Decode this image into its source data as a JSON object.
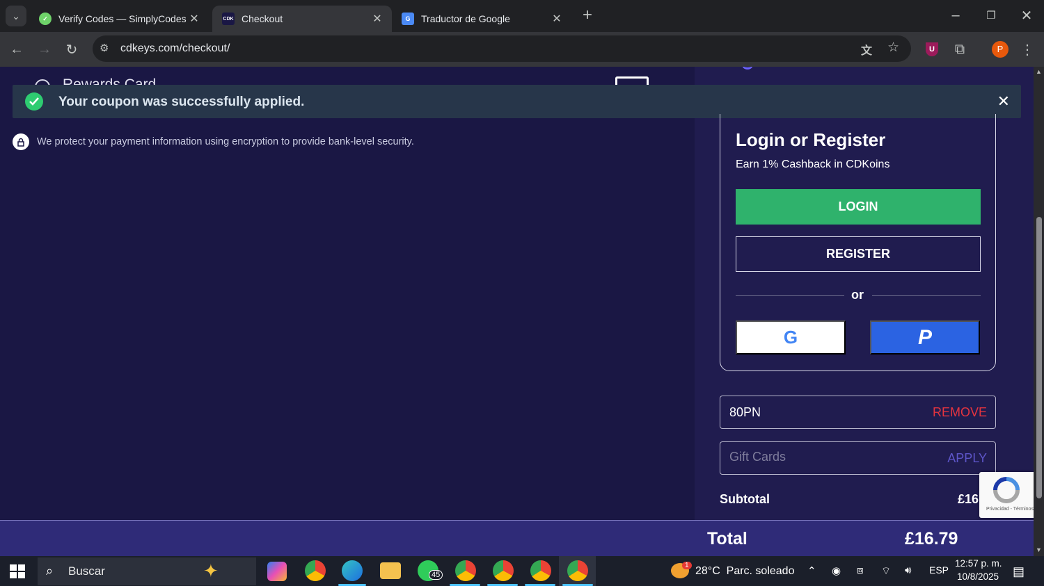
{
  "browser": {
    "tabs": [
      {
        "title": "Verify Codes — SimplyCodes",
        "favicon": "simplycodes-icon"
      },
      {
        "title": "Checkout",
        "favicon": "cdkeys-icon",
        "favicon_text": "CDK"
      },
      {
        "title": "Traductor de Google",
        "favicon": "google-translate-icon"
      }
    ],
    "url": "cdkeys.com/checkout/",
    "profile_initial": "P",
    "extension_badge": "U"
  },
  "page": {
    "hidden_option_label": "Rewards Card",
    "toast": {
      "message": "Your coupon was successfully applied."
    },
    "security_note": "We protect your payment information using encryption to provide bank-level security.",
    "auth": {
      "title": "Login or Register",
      "subtitle": "Earn 1% Cashback in CDKoins",
      "login_label": "LOGIN",
      "register_label": "REGISTER",
      "or_label": "or",
      "google_icon_letter": "G",
      "paypal_icon_letter": "P"
    },
    "coupon": {
      "code": "80PN",
      "action": "REMOVE"
    },
    "gift_card": {
      "placeholder": "Gift Cards",
      "action": "APPLY"
    },
    "subtotal": {
      "label": "Subtotal",
      "value": "£16"
    },
    "total": {
      "label": "Total",
      "value": "£16.79"
    },
    "recaptcha_text": "Privacidad - Términos"
  },
  "taskbar": {
    "search_placeholder": "Buscar",
    "whatsapp_badge": "45",
    "weather_badge": "1",
    "weather": "28°C  Parc. soleado",
    "language": "ESP",
    "time": "12:57 p. m.",
    "date": "10/8/2025"
  },
  "colors": {
    "page_bg": "#1a1744",
    "panel_bg": "#201c4f",
    "login_green": "#2fb26c",
    "paypal_blue": "#2b63e2",
    "remove_red": "#e5343f",
    "apply_purple": "#5d55c8",
    "total_bar": "#2f2b78",
    "toast_bg": "#27364a",
    "success_green": "#2ecc71"
  }
}
